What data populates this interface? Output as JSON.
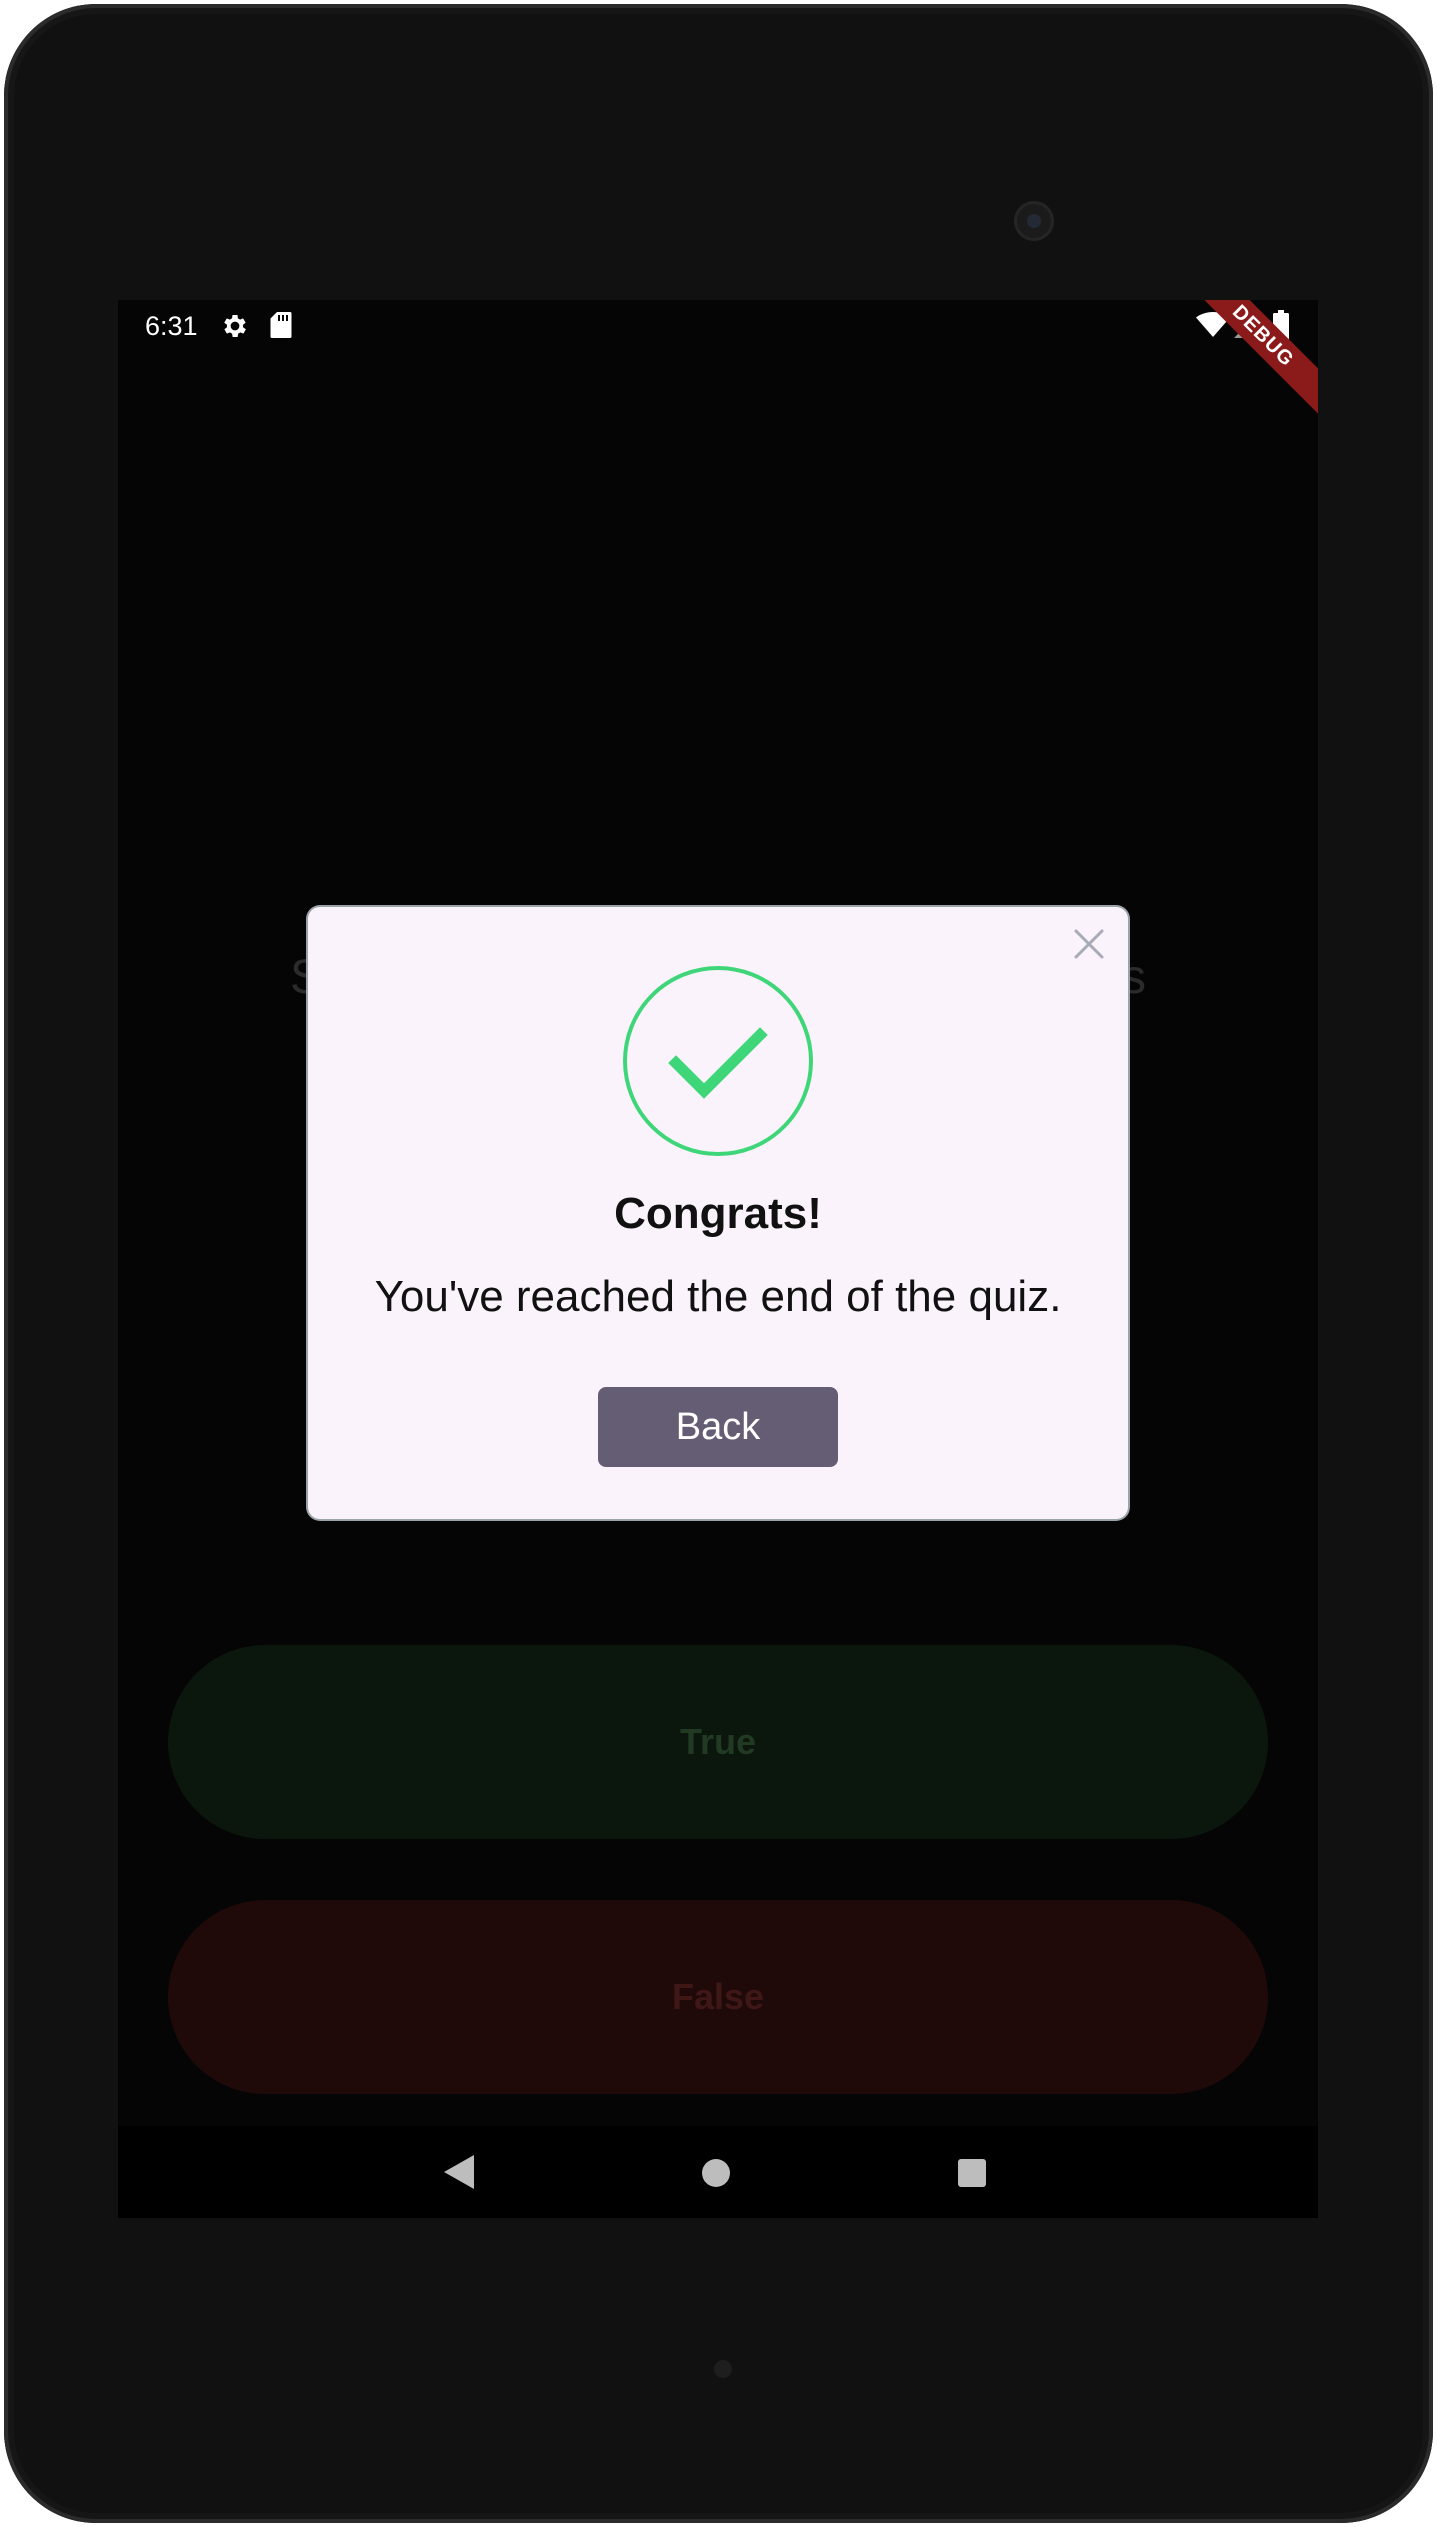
{
  "status_bar": {
    "time": "6:31",
    "icons": [
      "gear-icon",
      "sd-card-icon",
      "wifi-icon",
      "signal-icon",
      "battery-icon"
    ]
  },
  "debug_banner": "DEBUG",
  "quiz": {
    "question_visible_left": "So",
    "question_visible_right": "ans",
    "true_label": "True",
    "false_label": "False"
  },
  "dialog": {
    "title": "Congrats!",
    "message": "You've reached the end of the quiz.",
    "button_label": "Back",
    "icon": "check-circle-icon",
    "close_icon": "close-icon"
  },
  "colors": {
    "dialog_background": "#fbf3fb",
    "success_green": "#3fd67a",
    "button_purple": "#645d74",
    "true_button": "#0b170c",
    "false_button": "#1f0a09",
    "debug_banner": "#8b1a1a"
  },
  "nav_bar": {
    "icons": [
      "back-icon",
      "home-icon",
      "recents-icon"
    ]
  }
}
